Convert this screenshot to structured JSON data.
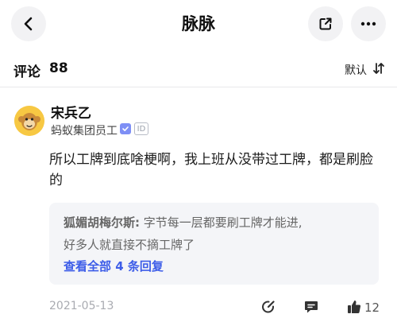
{
  "header": {
    "title": "脉脉",
    "icons": [
      "back-arrow-icon",
      "share-icon",
      "more-icon"
    ]
  },
  "comments": {
    "label": "评论",
    "count": "88",
    "sort_label": "默认"
  },
  "comment": {
    "author": "宋兵乙",
    "company": "蚂蚁集团员工",
    "id_badge": "ID",
    "text": "所以工牌到底啥梗啊，我上班从没带过工牌，都是刷脸的",
    "date": "2021-05-13",
    "like_count": "12",
    "reply_preview": {
      "author": "狐媚胡梅尔斯:",
      "line1": "字节每一层都要刷工牌才能进,",
      "line2": "好多人就直接不摘工牌了",
      "view_all": "查看全部 4 条回复"
    }
  },
  "colors": {
    "accent": "#3d5de8",
    "verified": "#7e8ff5",
    "avatar": "#f7c843"
  }
}
